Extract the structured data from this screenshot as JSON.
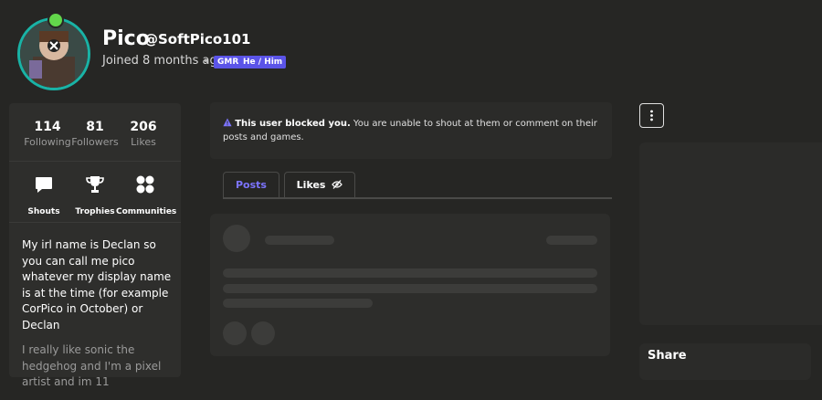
{
  "profile": {
    "display_name": "Pico",
    "handle": "@SoftPico101",
    "joined": "Joined 8 months ago",
    "separator": "•",
    "badges": [
      "GMR",
      "He / Him"
    ]
  },
  "stats": [
    {
      "value": "114",
      "label": "Following"
    },
    {
      "value": "81",
      "label": "Followers"
    },
    {
      "value": "206",
      "label": "Likes"
    }
  ],
  "nav": [
    {
      "label": "Shouts",
      "icon": "chat-bubble-icon"
    },
    {
      "label": "Trophies",
      "icon": "trophy-icon"
    },
    {
      "label": "Communities",
      "icon": "communities-icon"
    }
  ],
  "bio": {
    "paragraph1": "My irl name is Declan so you can call me pico whatever my display name is at the time (for example CorPico in October) or Declan",
    "paragraph2": "I really like sonic the hedgehog and I'm a pixel artist and im 11"
  },
  "alert": {
    "bold": "This user blocked you.",
    "text": " You are unable to shout at them or comment on their posts and games."
  },
  "tabs": [
    {
      "label": "Posts",
      "active": true
    },
    {
      "label": "Likes",
      "active": false
    }
  ],
  "share": {
    "title": "Share"
  },
  "colors": {
    "background": "#262624",
    "accent": "#7c74ff",
    "badge": "#5b54e8",
    "avatar_ring": "#19b3a6"
  }
}
